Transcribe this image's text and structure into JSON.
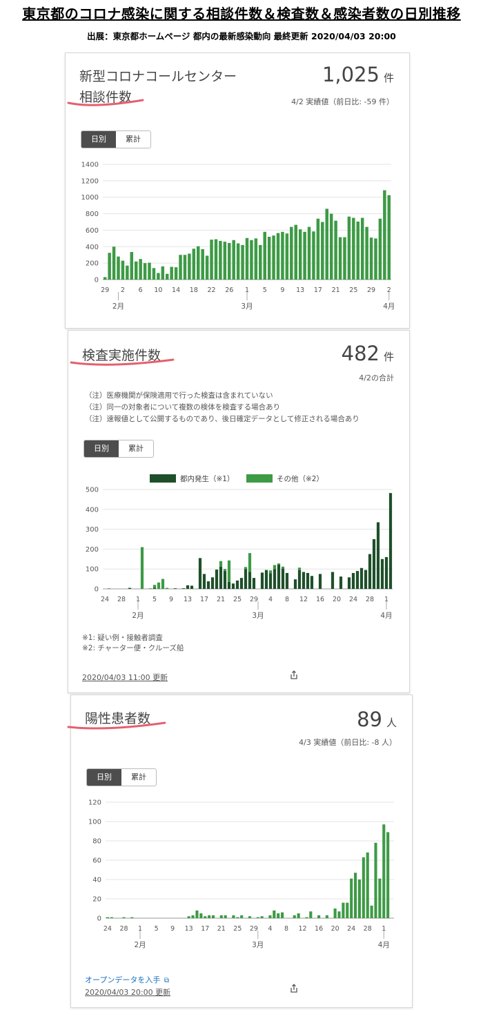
{
  "header": {
    "title": "東京都のコロナ感染に関する相談件数＆検査数＆感染者数の日別推移",
    "source": "出展：東京都ホームページ 都内の最新感染動向 最終更新 2020/04/03 20:00"
  },
  "colors": {
    "bar": "#3d9a45",
    "bar_dark": "#1f4f2a",
    "underline": "#e4606d",
    "toggle_active": "#4d4d4d"
  },
  "cards": {
    "consult": {
      "title_line1": "新型コロナコールセンター",
      "title_line2": "相談件数",
      "value": "1,025",
      "unit": "件",
      "sub": "4/2 実績値（前日比: -59 件）",
      "toggle": {
        "daily": "日別",
        "cumulative": "累計"
      }
    },
    "tests": {
      "title": "検査実施件数",
      "value": "482",
      "unit": "件",
      "sub": "4/2の合計",
      "notes": [
        "（注）医療機関が保険適用で行った検査は含まれていない",
        "（注）同一の対象者について複数の検体を検査する場合あり",
        "（注）速報値として公開するものであり、後日確定データとして修正される場合あり"
      ],
      "toggle": {
        "daily": "日別",
        "cumulative": "累計"
      },
      "footnotes": [
        "※1: 疑い例・接触者調査",
        "※2: チャーター便・クルーズ船"
      ],
      "updated": "2020/04/03 11:00 更新"
    },
    "positive": {
      "title": "陽性患者数",
      "value": "89",
      "unit": "人",
      "sub": "4/3 実績値（前日比: -8 人）",
      "toggle": {
        "daily": "日別",
        "cumulative": "累計"
      },
      "opendata": "オープンデータを入手",
      "updated": "2020/04/03 20:00 更新"
    }
  },
  "chart_data": [
    {
      "type": "bar",
      "ylim": [
        0,
        1400
      ],
      "yticks": [
        0,
        200,
        400,
        600,
        800,
        1000,
        1200,
        1400
      ],
      "tick_labels": [
        "29",
        "2",
        "6",
        "10",
        "14",
        "18",
        "22",
        "26",
        "1",
        "5",
        "9",
        "13",
        "17",
        "21",
        "25",
        "29",
        "2"
      ],
      "month_labels": [
        "2月",
        "3月",
        "4月"
      ],
      "categories": [
        "1/29",
        "1/30",
        "1/31",
        "2/1",
        "2/2",
        "2/3",
        "2/4",
        "2/5",
        "2/6",
        "2/7",
        "2/8",
        "2/9",
        "2/10",
        "2/11",
        "2/12",
        "2/13",
        "2/14",
        "2/15",
        "2/16",
        "2/17",
        "2/18",
        "2/19",
        "2/20",
        "2/21",
        "2/22",
        "2/23",
        "2/24",
        "2/25",
        "2/26",
        "2/27",
        "2/28",
        "2/29",
        "3/1",
        "3/2",
        "3/3",
        "3/4",
        "3/5",
        "3/6",
        "3/7",
        "3/8",
        "3/9",
        "3/10",
        "3/11",
        "3/12",
        "3/13",
        "3/14",
        "3/15",
        "3/16",
        "3/17",
        "3/18",
        "3/19",
        "3/20",
        "3/21",
        "3/22",
        "3/23",
        "3/24",
        "3/25",
        "3/26",
        "3/27",
        "3/28",
        "3/29",
        "3/30",
        "3/31",
        "4/1",
        "4/2"
      ],
      "values": [
        30,
        325,
        400,
        280,
        230,
        170,
        335,
        220,
        250,
        200,
        205,
        140,
        80,
        160,
        70,
        155,
        150,
        300,
        300,
        315,
        375,
        405,
        370,
        290,
        485,
        490,
        470,
        460,
        445,
        480,
        440,
        420,
        505,
        480,
        500,
        420,
        580,
        520,
        535,
        565,
        580,
        560,
        640,
        665,
        610,
        580,
        640,
        585,
        740,
        700,
        860,
        800,
        715,
        515,
        515,
        765,
        750,
        705,
        750,
        640,
        510,
        500,
        740,
        1085,
        1025
      ]
    },
    {
      "type": "bar",
      "ylim": [
        0,
        500
      ],
      "yticks": [
        0,
        100,
        200,
        300,
        400,
        500
      ],
      "tick_labels": [
        "24",
        "28",
        "1",
        "5",
        "9",
        "13",
        "17",
        "21",
        "25",
        "29",
        "4",
        "8",
        "12",
        "16",
        "20",
        "24",
        "28",
        "1"
      ],
      "month_labels": [
        "2月",
        "3月",
        "4月"
      ],
      "legend": [
        "都内発生（※1）",
        "その他（※2）"
      ],
      "categories": [
        "1/24",
        "1/25",
        "1/26",
        "1/27",
        "1/28",
        "1/29",
        "1/30",
        "1/31",
        "2/1",
        "2/2",
        "2/3",
        "2/4",
        "2/5",
        "2/6",
        "2/7",
        "2/8",
        "2/9",
        "2/10",
        "2/11",
        "2/12",
        "2/13",
        "2/14",
        "2/15",
        "2/16",
        "2/17",
        "2/18",
        "2/19",
        "2/20",
        "2/21",
        "2/22",
        "2/23",
        "2/24",
        "2/25",
        "2/26",
        "2/27",
        "2/28",
        "2/29",
        "3/1",
        "3/2",
        "3/3",
        "3/4",
        "3/5",
        "3/6",
        "3/7",
        "3/8",
        "3/9",
        "3/10",
        "3/11",
        "3/12",
        "3/13",
        "3/14",
        "3/15",
        "3/16",
        "3/17",
        "3/18",
        "3/19",
        "3/20",
        "3/21",
        "3/22",
        "3/23",
        "3/24",
        "3/25",
        "3/26",
        "3/27",
        "3/28",
        "3/29",
        "3/30",
        "3/31",
        "4/1",
        "4/2"
      ],
      "series": [
        {
          "name": "都内発生（※1）",
          "values": [
            0,
            2,
            0,
            0,
            0,
            0,
            5,
            0,
            0,
            0,
            0,
            2,
            5,
            0,
            0,
            0,
            0,
            3,
            0,
            3,
            18,
            16,
            0,
            155,
            75,
            38,
            58,
            97,
            112,
            90,
            35,
            27,
            42,
            55,
            100,
            85,
            55,
            0,
            82,
            95,
            78,
            100,
            122,
            102,
            80,
            0,
            48,
            95,
            85,
            80,
            65,
            0,
            75,
            0,
            0,
            85,
            0,
            62,
            0,
            58,
            80,
            90,
            105,
            95,
            175,
            250,
            335,
            150,
            160,
            482
          ]
        },
        {
          "name": "その他（※2）",
          "values": [
            0,
            0,
            0,
            0,
            0,
            0,
            0,
            0,
            0,
            210,
            0,
            0,
            15,
            32,
            50,
            5,
            0,
            0,
            0,
            0,
            0,
            0,
            0,
            0,
            0,
            0,
            0,
            0,
            28,
            10,
            108,
            0,
            0,
            0,
            10,
            95,
            0,
            0,
            0,
            0,
            15,
            20,
            6,
            10,
            0,
            0,
            0,
            12,
            0,
            0,
            0,
            0,
            0,
            0,
            0,
            0,
            0,
            0,
            0,
            0,
            0,
            0,
            0,
            0,
            0,
            0,
            0,
            0,
            0,
            0
          ]
        }
      ]
    },
    {
      "type": "bar",
      "ylim": [
        0,
        120
      ],
      "yticks": [
        0,
        20,
        40,
        60,
        80,
        100,
        120
      ],
      "tick_labels": [
        "24",
        "28",
        "1",
        "5",
        "9",
        "13",
        "17",
        "21",
        "25",
        "29",
        "4",
        "8",
        "12",
        "16",
        "20",
        "24",
        "28",
        "1"
      ],
      "month_labels": [
        "2月",
        "3月",
        "4月"
      ],
      "categories": [
        "1/24",
        "1/25",
        "1/26",
        "1/27",
        "1/28",
        "1/29",
        "1/30",
        "1/31",
        "2/1",
        "2/2",
        "2/3",
        "2/4",
        "2/5",
        "2/6",
        "2/7",
        "2/8",
        "2/9",
        "2/10",
        "2/11",
        "2/12",
        "2/13",
        "2/14",
        "2/15",
        "2/16",
        "2/17",
        "2/18",
        "2/19",
        "2/20",
        "2/21",
        "2/22",
        "2/23",
        "2/24",
        "2/25",
        "2/26",
        "2/27",
        "2/28",
        "2/29",
        "3/1",
        "3/2",
        "3/3",
        "3/4",
        "3/5",
        "3/6",
        "3/7",
        "3/8",
        "3/9",
        "3/10",
        "3/11",
        "3/12",
        "3/13",
        "3/14",
        "3/15",
        "3/16",
        "3/17",
        "3/18",
        "3/19",
        "3/20",
        "3/21",
        "3/22",
        "3/23",
        "3/24",
        "3/25",
        "3/26",
        "3/27",
        "3/28",
        "3/29",
        "3/30",
        "3/31",
        "4/1",
        "4/2",
        "4/3"
      ],
      "values": [
        1,
        1,
        0,
        0,
        1,
        0,
        1,
        0,
        0,
        0,
        0,
        0,
        0,
        0,
        0,
        0,
        0,
        0,
        0,
        0,
        2,
        3,
        8,
        5,
        2,
        3,
        3,
        0,
        3,
        3,
        0,
        3,
        1,
        3,
        0,
        2,
        0,
        1,
        2,
        0,
        3,
        8,
        5,
        6,
        0,
        0,
        3,
        5,
        0,
        1,
        7,
        0,
        3,
        0,
        3,
        0,
        10,
        7,
        16,
        16,
        41,
        47,
        40,
        63,
        68,
        13,
        78,
        41,
        97,
        89,
        0
      ]
    }
  ]
}
